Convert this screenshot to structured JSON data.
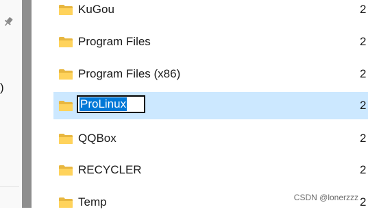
{
  "navigation": {
    "partial_text": ")",
    "pin_icon": "pin-icon"
  },
  "file_list": {
    "items": [
      {
        "name": "KuGou",
        "icon": "folder-icon",
        "date_partial": "2"
      },
      {
        "name": "Program Files",
        "icon": "folder-icon",
        "date_partial": "2"
      },
      {
        "name": "Program Files (x86)",
        "icon": "folder-icon",
        "date_partial": "2"
      },
      {
        "name": "ProLinux",
        "icon": "folder-icon",
        "date_partial": "2",
        "selected": true,
        "renaming": true
      },
      {
        "name": "QQBox",
        "icon": "folder-icon",
        "date_partial": "2"
      },
      {
        "name": "RECYCLER",
        "icon": "folder-icon",
        "date_partial": "2"
      },
      {
        "name": "Temp",
        "icon": "folder-icon",
        "date_partial": "2"
      }
    ]
  },
  "watermark": "CSDN @lonerzzz",
  "colors": {
    "selection_background": "#cce8ff",
    "rename_highlight": "#0078d7",
    "folder_yellow": "#ffd35c",
    "splitter": "#8e8e8e"
  }
}
